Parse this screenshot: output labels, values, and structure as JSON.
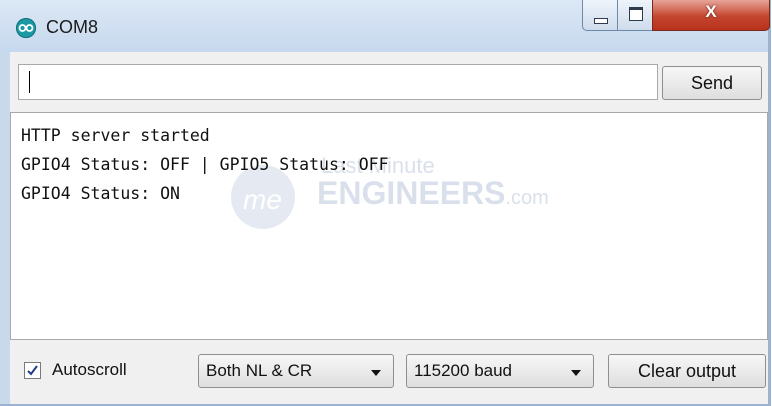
{
  "window": {
    "title": "COM8",
    "app_icon": "arduino-infinity-icon",
    "close_glyph": "X",
    "buttons": [
      "minimize",
      "maximize",
      "close"
    ]
  },
  "input": {
    "value": ""
  },
  "send_label": "Send",
  "output": {
    "lines": [
      "HTTP server started",
      "GPIO4 Status: OFF | GPIO5 Status: OFF",
      "GPIO4 Status: ON"
    ],
    "watermark": {
      "line1": "Last Minute",
      "line2": "ENGINEERS",
      "line3": ".com"
    }
  },
  "bottom": {
    "autoscroll_label": "Autoscroll",
    "autoscroll_checked": true,
    "line_ending": "Both NL & CR",
    "baud": "115200 baud",
    "clear_label": "Clear output"
  },
  "colors": {
    "titlebar": "#c6d8ee",
    "close_button": "#c4452e",
    "app_icon": "#1a9aa3"
  }
}
